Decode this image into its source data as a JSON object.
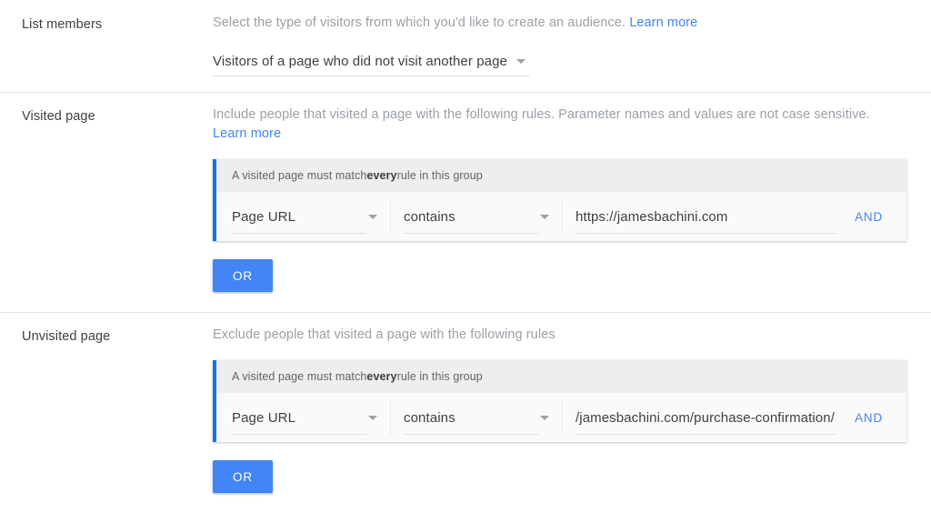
{
  "sections": [
    {
      "label": "List members",
      "description_prefix": "Select the type of visitors from which you'd like to create an audience. ",
      "description_link": "Learn more",
      "select_value": "Visitors of a page who did not visit another page"
    },
    {
      "label": "Visited page",
      "description_prefix": "Include people that visited a page with the following rules. Parameter names and values are not case sensitive. ",
      "description_link": "Learn more",
      "card": {
        "header_prefix": "A visited page must match ",
        "header_bold": "every",
        "header_suffix": " rule in this group",
        "dimension": "Page URL",
        "match_type": "contains",
        "value": "https://jamesbachini.com",
        "and_label": "AND"
      },
      "or_label": "OR"
    },
    {
      "label": "Unvisited page",
      "description_prefix": "Exclude people that visited a page with the following rules",
      "description_link": "",
      "card": {
        "header_prefix": "A visited page must match ",
        "header_bold": "every",
        "header_suffix": " rule in this group",
        "dimension": "Page URL",
        "match_type": "contains",
        "value": "/jamesbachini.com/purchase-confirmation/",
        "and_label": "AND"
      },
      "or_label": "OR"
    }
  ],
  "colors": {
    "accent_blue": "#4285f4",
    "card_bar_blue": "#1a73e8",
    "card_header_bg": "#eeeeee",
    "card_body_bg": "#fafafa",
    "text_primary": "#3c4043",
    "text_muted": "#9aa0a6",
    "divider": "#e6e6e6"
  }
}
